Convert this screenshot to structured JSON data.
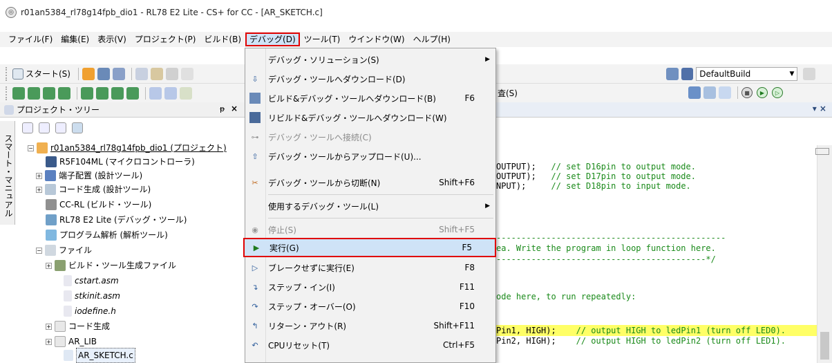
{
  "window": {
    "title": "r01an5384_rl78g14fpb_dio1 - RL78 E2 Lite - CS+ for CC - [AR_SKETCH.c]"
  },
  "menubar": {
    "items": [
      {
        "label": "ファイル(F)"
      },
      {
        "label": "編集(E)"
      },
      {
        "label": "表示(V)"
      },
      {
        "label": "プロジェクト(P)"
      },
      {
        "label": "ビルド(B)"
      },
      {
        "label": "デバッグ(D)"
      },
      {
        "label": "ツール(T)"
      },
      {
        "label": "ウインドウ(W)"
      },
      {
        "label": "ヘルプ(H)"
      }
    ],
    "active_index": 5
  },
  "toolbar": {
    "start_label": "スタート(S)",
    "build_config": "DefaultBuild",
    "partial_label": "査(S)"
  },
  "project_tree": {
    "title": "プロジェクト・ツリー",
    "pin_glyph": "ᵽ",
    "close_glyph": "×",
    "side_tab_label": "スマート・マニュアル",
    "items": [
      {
        "label": "r01an5384_rl78g14fpb_dio1 (プロジェクト)"
      },
      {
        "label": "R5F104ML (マイクロコントローラ)"
      },
      {
        "label": "端子配置 (設計ツール)"
      },
      {
        "label": "コード生成 (設計ツール)"
      },
      {
        "label": "CC-RL (ビルド・ツール)"
      },
      {
        "label": "RL78 E2 Lite (デバッグ・ツール)"
      },
      {
        "label": "プログラム解析 (解析ツール)"
      },
      {
        "label": "ファイル"
      },
      {
        "label": "ビルド・ツール生成ファイル"
      },
      {
        "label": "cstart.asm"
      },
      {
        "label": "stkinit.asm"
      },
      {
        "label": "iodefine.h"
      },
      {
        "label": "コード生成"
      },
      {
        "label": "AR_LIB"
      },
      {
        "label": "AR_SKETCH.c"
      }
    ]
  },
  "editor": {
    "close_glyph": "▾ ×",
    "lines": [
      {
        "code": "OUTPUT);",
        "comment": "   // set D16pin to output mode."
      },
      {
        "code": "OUTPUT);",
        "comment": "   // set D17pin to output mode."
      },
      {
        "code": "NPUT);",
        "comment": "     // set D18pin to input mode."
      },
      {
        "code": "----------------------------------------------",
        "comment": ""
      },
      {
        "code": "ea. Write the program in loop function here.",
        "comment": ""
      },
      {
        "code": "------------------------------------------*/",
        "comment": ""
      },
      {
        "code": "ode here, to run repeatedly:",
        "comment": ""
      },
      {
        "code": "Pin1, HIGH);",
        "comment": "    // output HIGH to ledPin1 (turn off LED0)."
      },
      {
        "code": "Pin2, HIGH);",
        "comment": "    // output HIGH to ledPin2 (turn off LED1)."
      }
    ]
  },
  "debug_menu": {
    "items": [
      {
        "label": "デバッグ・ソリューション(S)",
        "shortcut": "",
        "submenu": true,
        "icon": "none"
      },
      {
        "label": "デバッグ・ツールへダウンロード(D)",
        "shortcut": "",
        "icon": "download-icon"
      },
      {
        "label": "ビルド&デバッグ・ツールへダウンロード(B)",
        "shortcut": "F6",
        "icon": "build-download-icon"
      },
      {
        "label": "リビルド&デバッグ・ツールへダウンロード(W)",
        "shortcut": "",
        "icon": "rebuild-download-icon"
      },
      {
        "label": "デバッグ・ツールへ接続(C)",
        "shortcut": "",
        "disabled": true,
        "icon": "connect-icon"
      },
      {
        "label": "デバッグ・ツールからアップロード(U)...",
        "shortcut": "",
        "icon": "upload-icon"
      },
      {
        "label": "デバッグ・ツールから切断(N)",
        "shortcut": "Shift+F6",
        "icon": "disconnect-icon"
      },
      {
        "label": "使用するデバッグ・ツール(L)",
        "shortcut": "",
        "submenu": true,
        "icon": "none"
      },
      {
        "label": "停止(S)",
        "shortcut": "Shift+F5",
        "disabled": true,
        "icon": "stop-icon"
      },
      {
        "label": "実行(G)",
        "shortcut": "F5",
        "highlighted": true,
        "icon": "run-icon"
      },
      {
        "label": "ブレークせずに実行(E)",
        "shortcut": "F8",
        "icon": "run-no-break-icon"
      },
      {
        "label": "ステップ・イン(I)",
        "shortcut": "F11",
        "icon": "step-in-icon"
      },
      {
        "label": "ステップ・オーバー(O)",
        "shortcut": "F10",
        "icon": "step-over-icon"
      },
      {
        "label": "リターン・アウト(R)",
        "shortcut": "Shift+F11",
        "icon": "return-out-icon"
      },
      {
        "label": "CPUリセット(T)",
        "shortcut": "Ctrl+F5",
        "icon": "cpu-reset-icon"
      }
    ]
  },
  "colors": {
    "highlight_border": "#e00000",
    "menu_highlight": "#cfe3f7",
    "comment": "#1a8a1a",
    "current_line": "#ffff66"
  }
}
